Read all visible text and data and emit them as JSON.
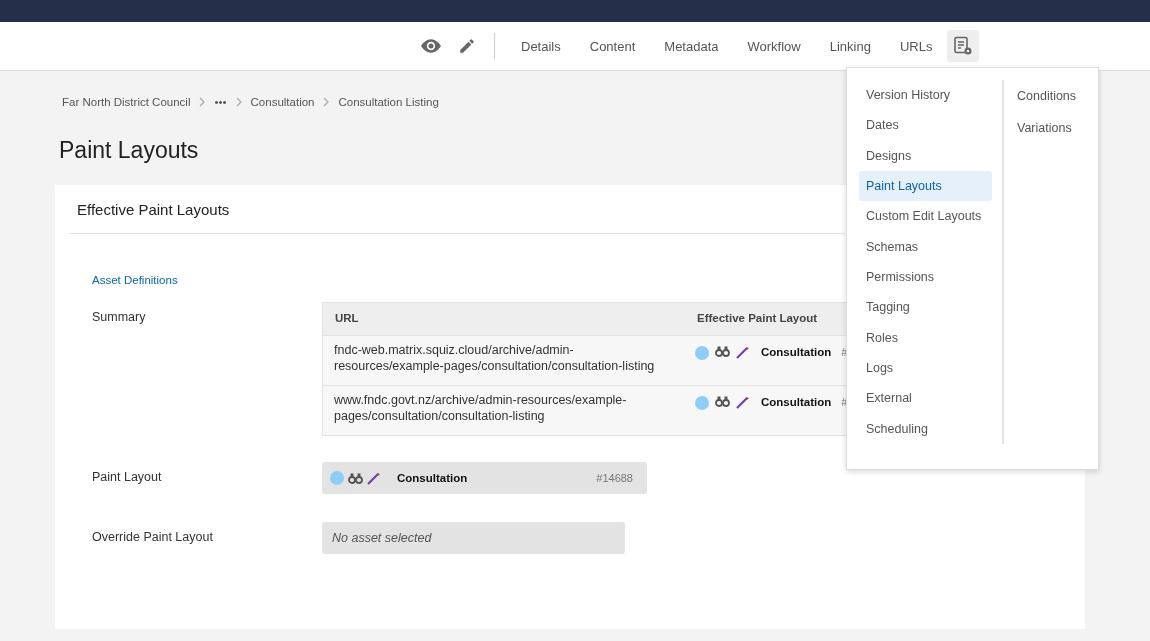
{
  "toolbar": {
    "nav": [
      {
        "label": "Details",
        "selected": false
      },
      {
        "label": "Content",
        "selected": false
      },
      {
        "label": "Metadata",
        "selected": false
      },
      {
        "label": "Workflow",
        "selected": false
      },
      {
        "label": "Linking",
        "selected": false
      },
      {
        "label": "URLs",
        "selected": false
      }
    ]
  },
  "breadcrumb": [
    "Far North District Council",
    "•••",
    "Consultation",
    "Consultation Listing"
  ],
  "title": "Paint Layouts",
  "card": {
    "title": "Effective Paint Layouts",
    "link": "Asset Definitions",
    "summary": {
      "label": "Summary",
      "columns": [
        "URL",
        "Effective Paint Layout"
      ],
      "rows": [
        {
          "url": "fndc-web.matrix.squiz.cloud/archive/admin-resources/example-pages/consultation/consultation-listing",
          "asset": "Consultation",
          "id": "#"
        },
        {
          "url": "www.fndc.govt.nz/archive/admin-resources/example-pages/consultation/consultation-listing",
          "asset": "Consultation",
          "id": "#"
        }
      ]
    },
    "paint_layout": {
      "label": "Paint Layout",
      "asset": "Consultation",
      "id": "#14688"
    },
    "override": {
      "label": "Override Paint Layout",
      "placeholder": "No asset selected"
    }
  },
  "menu": {
    "columns": [
      [
        {
          "label": "Version History",
          "selected": false
        },
        {
          "label": "Dates",
          "selected": false
        },
        {
          "label": "Designs",
          "selected": false
        },
        {
          "label": "Paint Layouts",
          "selected": true
        },
        {
          "label": "Custom Edit Layouts",
          "selected": false
        },
        {
          "label": "Schemas",
          "selected": false
        },
        {
          "label": "Permissions",
          "selected": false
        },
        {
          "label": "Tagging",
          "selected": false
        },
        {
          "label": "Roles",
          "selected": false
        },
        {
          "label": "Logs",
          "selected": false
        },
        {
          "label": "External",
          "selected": false
        },
        {
          "label": "Scheduling",
          "selected": false
        }
      ],
      [
        {
          "label": "Conditions",
          "selected": false
        },
        {
          "label": "Variations",
          "selected": false
        }
      ]
    ]
  }
}
